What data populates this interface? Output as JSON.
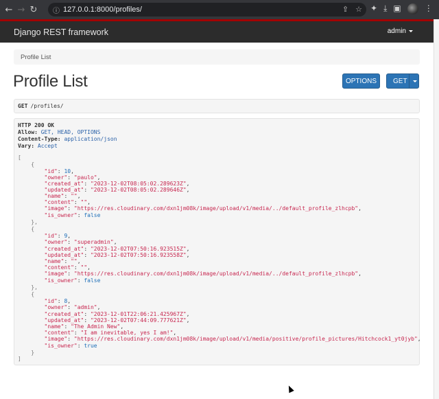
{
  "browser": {
    "url": "127.0.0.1:8000/profiles/",
    "back_icon": "back-arrow-icon",
    "forward_icon": "forward-arrow-icon",
    "reload_icon": "reload-icon"
  },
  "navbar": {
    "brand": "Django REST framework",
    "user": "admin"
  },
  "breadcrumb": {
    "current": "Profile List"
  },
  "page": {
    "title": "Profile List",
    "options_label": "OPTIONS",
    "get_label": "GET"
  },
  "request": {
    "method": "GET",
    "path": "/profiles/"
  },
  "response": {
    "status": "HTTP 200 OK",
    "allow_key": "Allow:",
    "allow_value": "GET, HEAD, OPTIONS",
    "content_type_key": "Content-Type:",
    "content_type_value": "application/json",
    "vary_key": "Vary:",
    "vary_value": "Accept",
    "profiles": [
      {
        "id": "10",
        "owner": "\"paulo\"",
        "created_at": "\"2023-12-02T08:05:02.289623Z\"",
        "updated_at": "\"2023-12-02T08:05:02.289646Z\"",
        "name": "\"\"",
        "content": "\"\"",
        "image": "\"https://res.cloudinary.com/dxn1jm08k/image/upload/v1/media/../default_profile_zlhcpb\"",
        "is_owner": "false"
      },
      {
        "id": "9",
        "owner": "\"superadmin\"",
        "created_at": "\"2023-12-02T07:50:16.923515Z\"",
        "updated_at": "\"2023-12-02T07:50:16.923558Z\"",
        "name": "\"\"",
        "content": "\"\"",
        "image": "\"https://res.cloudinary.com/dxn1jm08k/image/upload/v1/media/../default_profile_zlhcpb\"",
        "is_owner": "false"
      },
      {
        "id": "8",
        "owner": "\"admin\"",
        "created_at": "\"2023-12-01T22:06:21.425967Z\"",
        "updated_at": "\"2023-12-02T07:44:09.777621Z\"",
        "name": "\"The Admin New\"",
        "content": "\"I am inevitable, yes I am!\"",
        "image": "\"https://res.cloudinary.com/dxn1jm08k/image/upload/v1/media/positive/profile_pictures/Hitchcock1_yt0jyb\"",
        "is_owner": "true"
      }
    ]
  }
}
